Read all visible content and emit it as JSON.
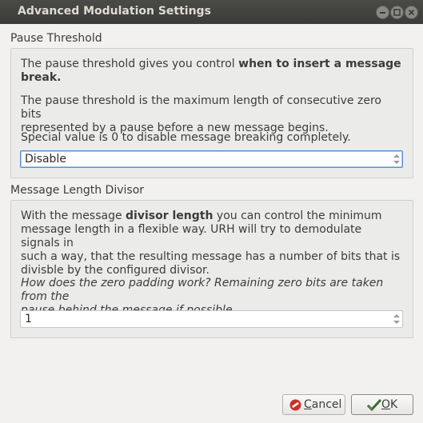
{
  "window": {
    "title": "Advanced Modulation Settings"
  },
  "pause": {
    "heading": "Pause Threshold",
    "intro_plain": "The pause threshold gives you control ",
    "intro_bold_line1": "when to insert a message",
    "intro_bold_line2": "break.",
    "desc_line1": "The pause threshold is the maximum length of consecutive zero bits",
    "desc_line2": "represented by a pause before a new message begins.",
    "special": "Special value is 0 to disable message breaking completely.",
    "spin_value": "Disable"
  },
  "divisor": {
    "heading": "Message Length Divisor",
    "l1_a": "With the message ",
    "l1_b": "divisor length",
    "l1_c": " you can control the minimum",
    "l2": "message length in a flexible way. URH will try to demodulate signals in",
    "l3": "such a way, that the resulting message has a number of bits that is",
    "l4": "divisble by the configured divisor.",
    "italic_l1": "How does the zero padding work? Remaining zero bits are taken from the",
    "italic_l2": "pause behind the message if possible.",
    "spin_value": "1"
  },
  "buttons": {
    "cancel_mnemonic": "C",
    "cancel_rest": "ancel",
    "ok_mnemonic": "O",
    "ok_rest": "K"
  },
  "colors": {
    "titlebar": "#3b3b38",
    "background": "#f2f1f0",
    "focus": "#5b8fcf",
    "cancel_icon": "#c7322c",
    "ok_icon": "#3d6a2d"
  }
}
